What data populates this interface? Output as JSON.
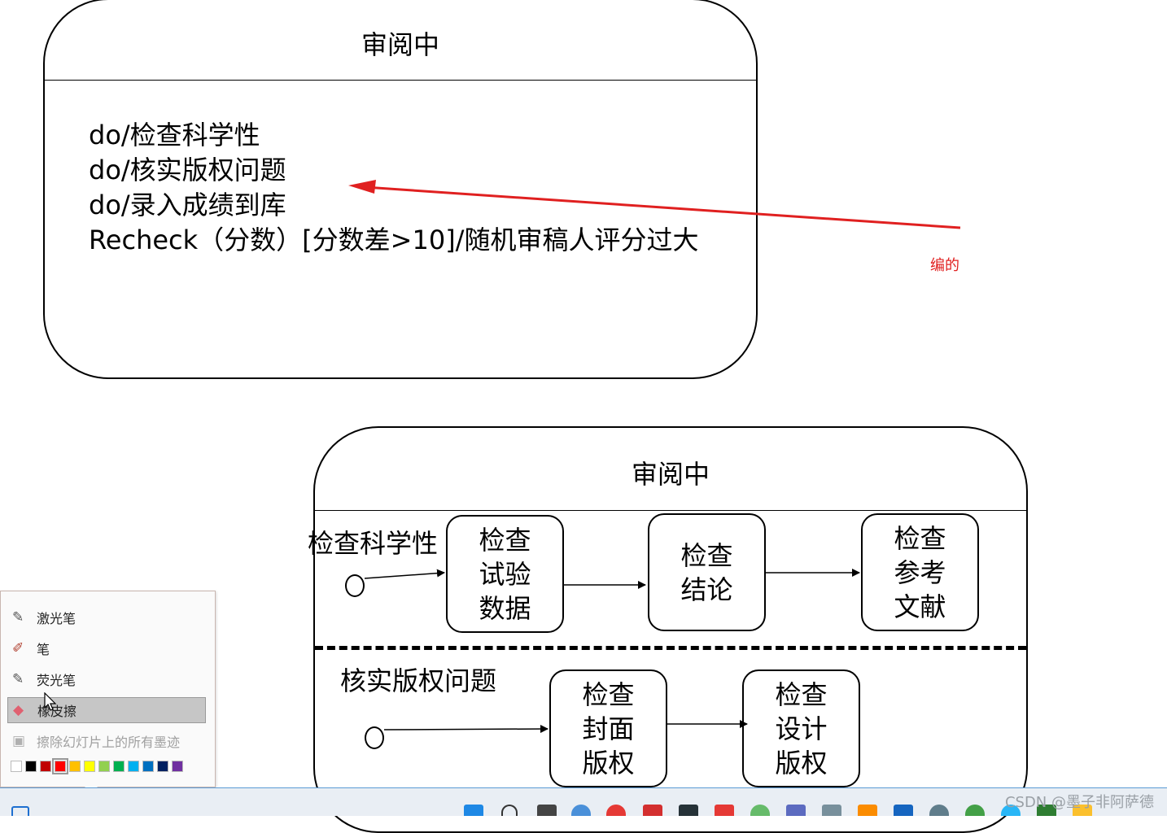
{
  "diagram_top": {
    "title": "审阅中",
    "actions": [
      "do/检查科学性",
      "do/核实版权问题",
      "do/录入成绩到库",
      "Recheck（分数）[分数差>10]/随机审稿人评分过大"
    ]
  },
  "annotation": {
    "note": "编的",
    "color": "#e02020"
  },
  "diagram_bottom": {
    "title": "审阅中",
    "region1": {
      "label": "检查科学性",
      "states": [
        "检查\n试验\n数据",
        "检查\n结论",
        "检查\n参考\n文献"
      ]
    },
    "region2": {
      "label": "核实版权问题",
      "states": [
        "检查\n封面\n版权",
        "检查\n设计\n版权"
      ]
    }
  },
  "ink_menu": {
    "items": [
      {
        "label": "激光笔",
        "icon": "laser-pointer-icon"
      },
      {
        "label": "笔",
        "icon": "pen-icon"
      },
      {
        "label": "荧光笔",
        "icon": "highlighter-icon"
      },
      {
        "label": "橡皮擦",
        "icon": "eraser-icon",
        "selected": true
      },
      {
        "label": "擦除幻灯片上的所有墨迹",
        "icon": "erase-all-icon",
        "disabled": true
      }
    ],
    "colors": [
      "#ffffff",
      "#000000",
      "#c00000",
      "#ff0000",
      "#ffc000",
      "#ffff00",
      "#92d050",
      "#00b050",
      "#00b0f0",
      "#0070c0",
      "#002060",
      "#7030a0"
    ],
    "selected_color": "#ff0000"
  },
  "watermark": "CSDN @墨子非阿萨德"
}
